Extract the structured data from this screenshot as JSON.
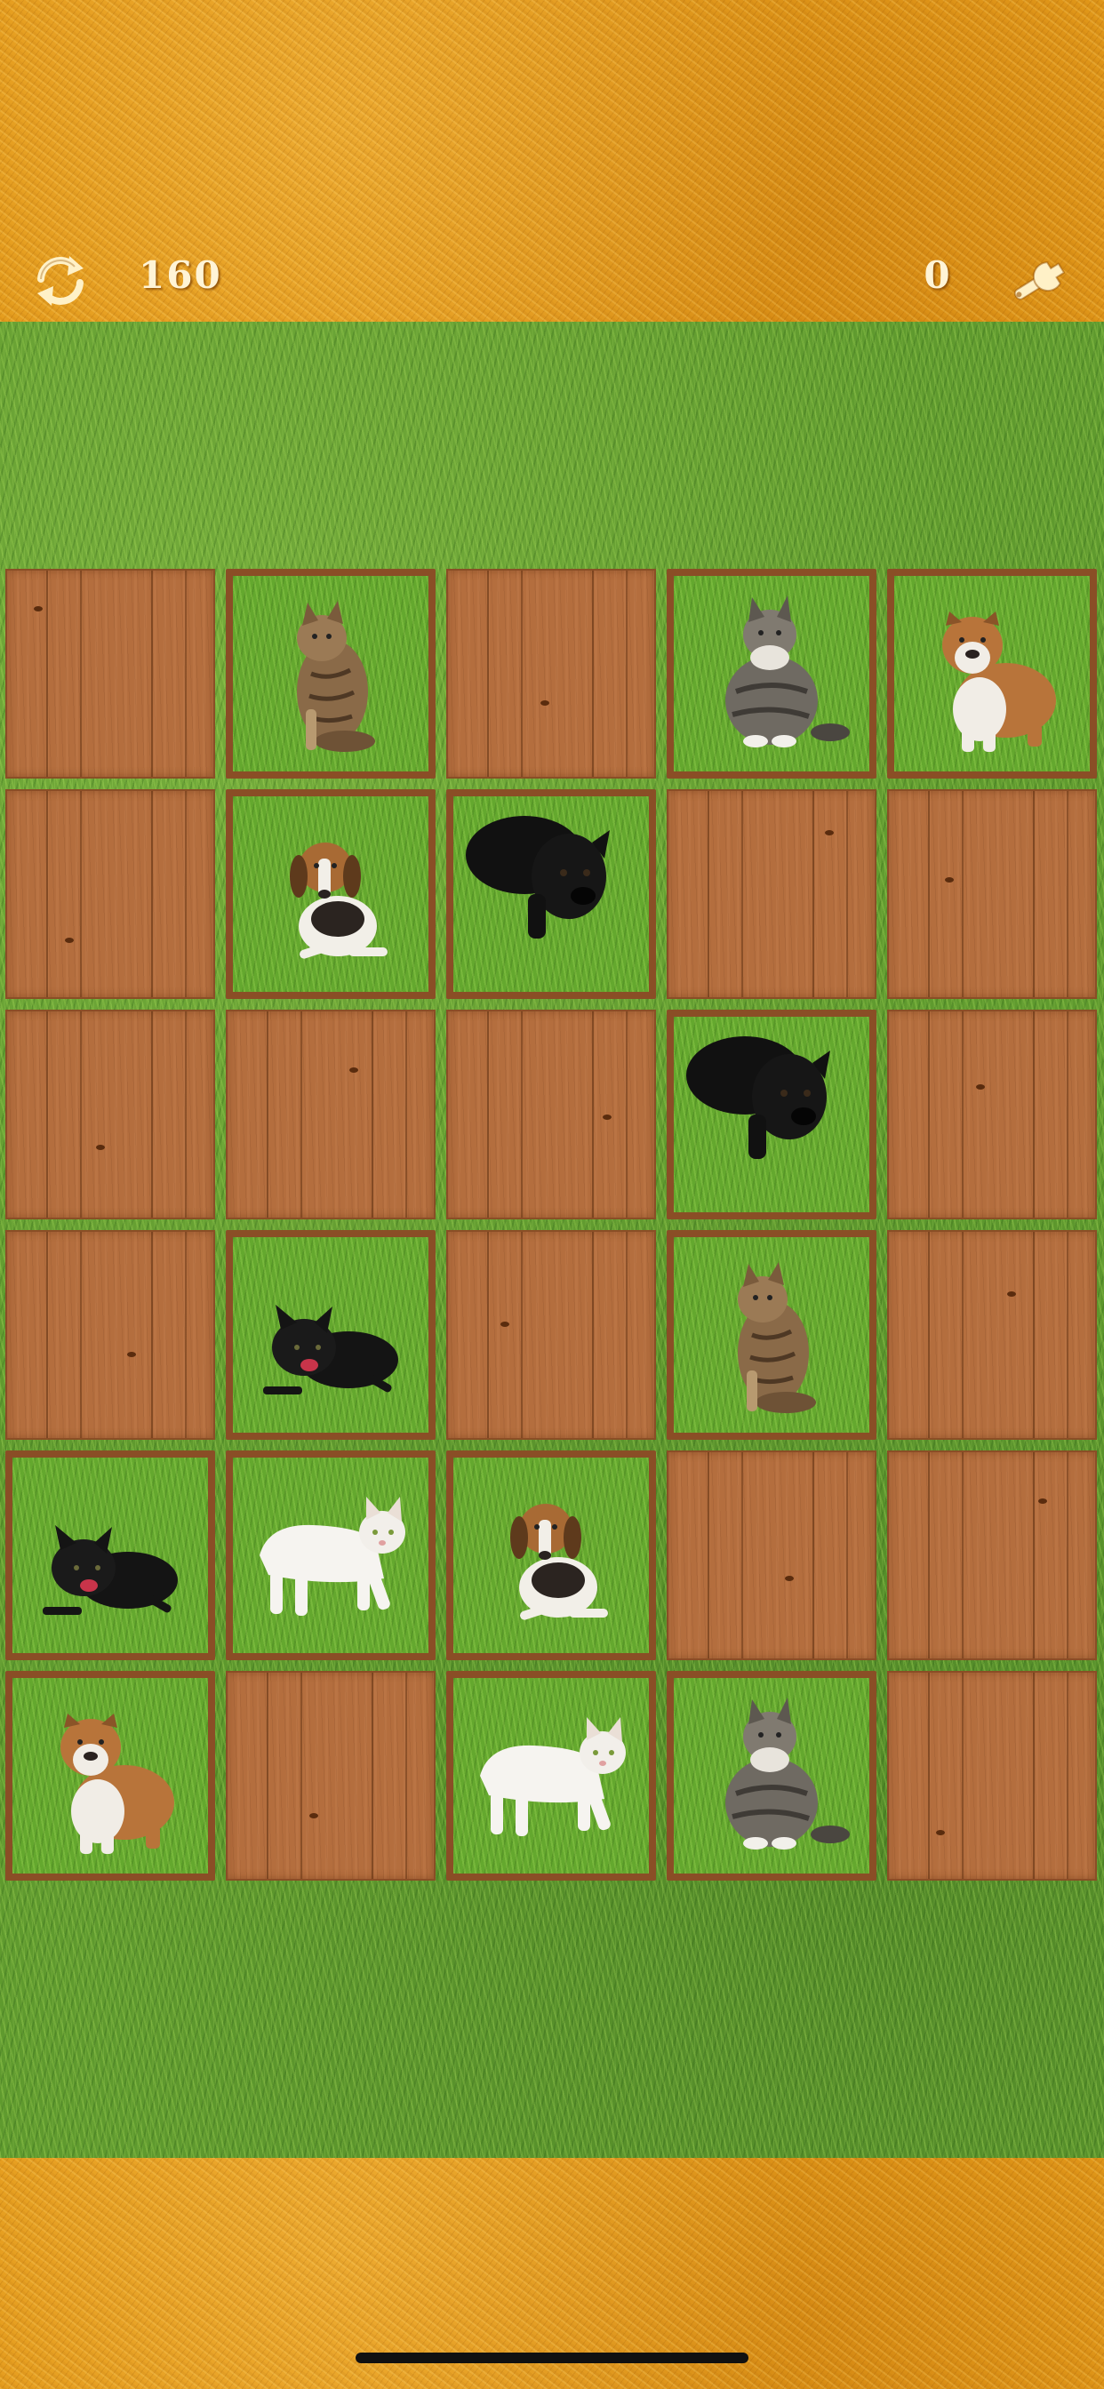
{
  "hud": {
    "score": "160",
    "moves": "0",
    "refresh_icon": "refresh-icon",
    "settings_icon": "wrench-icon"
  },
  "board": {
    "rows": 6,
    "cols": 5,
    "tiles": [
      "back",
      "tabby-cat",
      "back",
      "maine-coon-cat",
      "bulldog",
      "back",
      "beagle-puppy",
      "black-labrador",
      "back",
      "back",
      "back",
      "back",
      "back",
      "black-labrador",
      "back",
      "back",
      "black-kitten",
      "back",
      "tabby-cat",
      "back",
      "black-kitten",
      "white-cat",
      "beagle-puppy",
      "back",
      "back",
      "bulldog",
      "back",
      "white-cat",
      "maine-coon-cat",
      "back"
    ]
  },
  "colors": {
    "top_bar": "#e39a1a",
    "grass": "#5f9a2e",
    "wood": "#b46e3e",
    "hud_text": "#fff4d6"
  }
}
